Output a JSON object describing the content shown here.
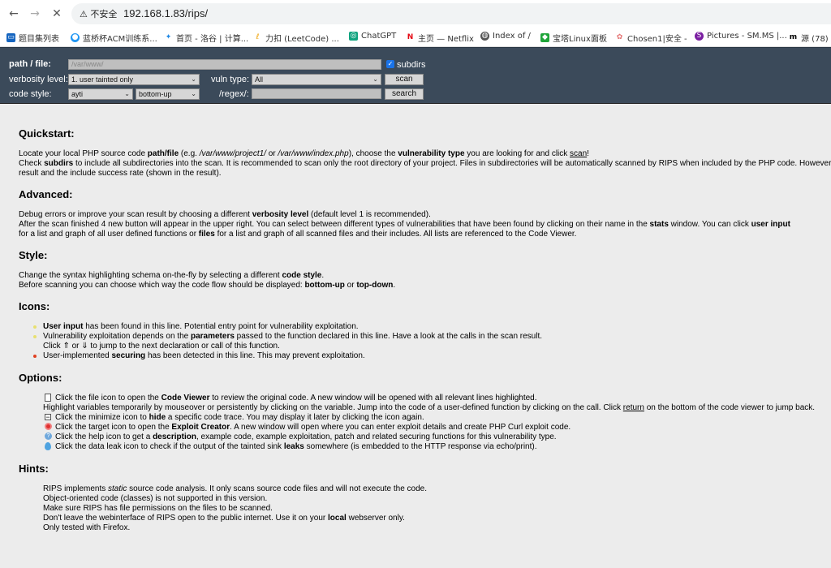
{
  "browser": {
    "url": "192.168.1.83/rips/",
    "security_label": "不安全",
    "bookmarks": [
      "题目集列表",
      "蓝桥杯ACM训练系...",
      "首页 - 洛谷 | 计算...",
      "力扣 (LeetCode) ...",
      "ChatGPT",
      "主页 — Netflix",
      "Index of /",
      "宝塔Linux面板",
      "Chosen1|安全 -",
      "Pictures - SM.MS |...",
      "源 (78) -"
    ]
  },
  "toolbar": {
    "path_label": "path / file:",
    "path_value": "/var/www/",
    "subdirs_label": "subdirs",
    "verbosity_label": "verbosity level:",
    "verbosity_value": "1. user tainted only",
    "vuln_label": "vuln type:",
    "vuln_value": "All",
    "scan_label": "scan",
    "code_style_label": "code style:",
    "code_style_value": "ayti",
    "flow_value": "bottom-up",
    "regex_label": "/regex/:",
    "search_label": "search"
  },
  "content": {
    "quickstart_title": "Quickstart:",
    "advanced_title": "Advanced:",
    "style_title": "Style:",
    "icons_title": "Icons:",
    "options_title": "Options:",
    "hints_title": "Hints:",
    "q1a": "Locate your local PHP source code ",
    "q1b": "path/file",
    "q1c": " (e.g. ",
    "q1d": "/var/www/project1/",
    "q1e": " or ",
    "q1f": "/var/www/index.php",
    "q1g": "), choose the ",
    "q1h": "vulnerability type",
    "q1i": " you are looking for and click ",
    "q1j": "scan",
    "q1k": "!",
    "q2a": "Check ",
    "q2b": "subdirs",
    "q2c": " to include all subdirectories into the scan. It is recommended to scan only the root directory of your project. Files in subdirectories will be automatically scanned by RIPS when included by the PHP code. However, you can scan",
    "q3": "result and the include success rate (shown in the result).",
    "a1a": "Debug errors or improve your scan result by choosing a different ",
    "a1b": "verbosity level",
    "a1c": " (default level 1 is recommended).",
    "a2a": "After the scan finished 4 new button will appear in the upper right. You can select between different types of vulnerabilities that have been found by clicking on their name in the ",
    "a2b": "stats",
    "a2c": " window. You can click ",
    "a2d": "user input",
    "a3a": "for a list and graph of all user defined functions or ",
    "a3b": "files",
    "a3c": " for a list and graph of all scanned files and their includes. All lists are referenced to the Code Viewer.",
    "s1a": "Change the syntax highlighting schema on-the-fly by selecting a different ",
    "s1b": "code style",
    "s1c": ".",
    "s2a": "Before scanning you can choose which way the code flow should be displayed: ",
    "s2b": "bottom-up",
    "s2c": " or ",
    "s2d": "top-down",
    "s2e": ".",
    "i1a": "User input",
    "i1b": " has been found in this line. Potential entry point for vulnerability exploitation.",
    "i2a": "Vulnerability exploitation depends on the ",
    "i2b": "parameters",
    "i2c": " passed to the function declared in this line. Have a look at the calls in the scan result.",
    "i3": "Click ⇑ or ⇓ to jump to the next declaration or call of this function.",
    "i4a": "User-implemented ",
    "i4b": "securing",
    "i4c": " has been detected in this line. This may prevent exploitation.",
    "o1a": "Click the file icon to open the ",
    "o1b": "Code Viewer",
    "o1c": " to review the original code. A new window will be opened with all relevant lines highlighted.",
    "o2a": "Highlight variables temporarily by mouseover or persistently by clicking on the variable. Jump into the code of a user-defined function by clicking on the call. Click ",
    "o2b": "return",
    "o2c": " on the bottom of the code viewer to jump back.",
    "o3a": "Click the minimize icon to ",
    "o3b": "hide",
    "o3c": " a specific code trace. You may display it later by clicking the icon again.",
    "o4a": "Click the target icon to open the ",
    "o4b": "Exploit Creator",
    "o4c": ". A new window will open where you can enter exploit details and create PHP Curl exploit code.",
    "o5a": "Click the help icon to get a ",
    "o5b": "description",
    "o5c": ", example code, example exploitation, patch and related securing functions for this vulnerability type.",
    "o6a": "Click the data leak icon to check if the output of the tainted sink ",
    "o6b": "leaks",
    "o6c": " somewhere (is embedded to the HTTP response via echo/print).",
    "h1a": "RIPS implements ",
    "h1b": "static",
    "h1c": " source code analysis. It only scans source code files and will not execute the code.",
    "h2": "Object-oriented code (classes) is not supported in this version.",
    "h3": "Make sure RIPS has file permissions on the files to be scanned.",
    "h4a": "Don't leave the webinterface of RIPS open to the public internet. Use it on your ",
    "h4b": "local",
    "h4c": " webserver only.",
    "h5": "Only tested with Firefox."
  },
  "colors": {
    "toolbar_bg": "#3b4a5a",
    "page_bg": "#ececec"
  }
}
